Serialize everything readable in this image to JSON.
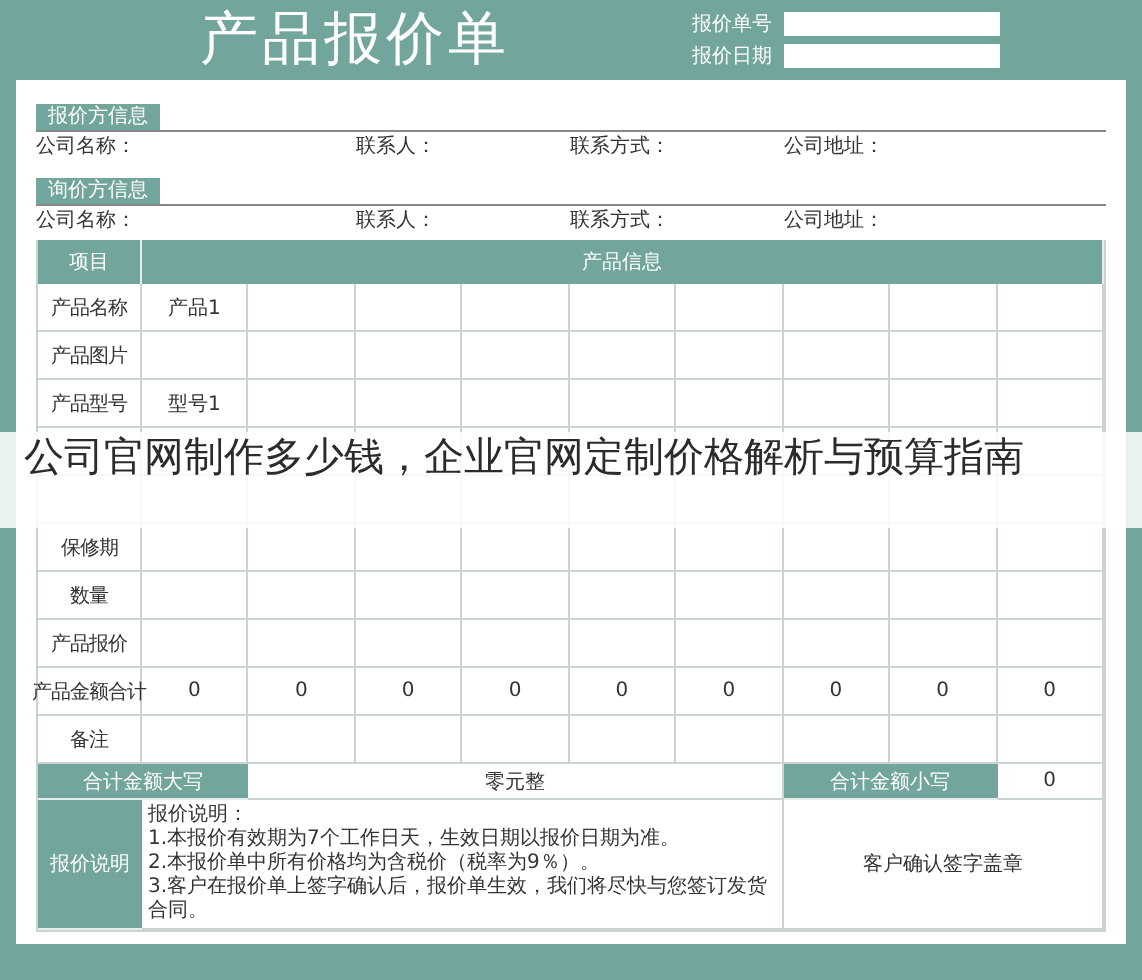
{
  "header": {
    "title": "产品报价单",
    "fields": [
      {
        "label": "报价单号"
      },
      {
        "label": "报价日期"
      }
    ]
  },
  "sections": [
    {
      "heading": "报价方信息",
      "fields": [
        "公司名称：",
        "联系人：",
        "联系方式：",
        "公司地址："
      ]
    },
    {
      "heading": "询价方信息",
      "fields": [
        "公司名称：",
        "联系人：",
        "联系方式：",
        "公司地址："
      ]
    }
  ],
  "table": {
    "columns": [
      "项目",
      "产品信息"
    ],
    "rows": [
      {
        "label": "产品名称",
        "values": [
          "产品1"
        ]
      },
      {
        "label": "产品图片",
        "values": []
      },
      {
        "label": "产品型号",
        "values": [
          "型号1"
        ]
      },
      {
        "values": []
      },
      {
        "values": []
      },
      {
        "label": "保修期",
        "values": []
      },
      {
        "label": "数量",
        "values": []
      },
      {
        "label": "产品报价",
        "values": []
      },
      {
        "label": "产品金额合计",
        "values": [
          "0",
          "0",
          "0",
          "0",
          "0",
          "0",
          "0",
          "0",
          "0"
        ]
      },
      {
        "label": "备注",
        "values": []
      }
    ]
  },
  "totals": {
    "upper_label": "合计金额大写",
    "upper_value": "零元整",
    "lower_label": "合计金额小写",
    "lower_value": "0"
  },
  "notes": {
    "label": "报价说明",
    "heading": "报价说明：",
    "lines": [
      "1.本报价有效期为7个工作日天，生效日期以报价日期为准。",
      "2.本报价单中所有价格均为含税价（税率为9％）。",
      "3.客户在报价单上签字确认后，报价单生效，我们将尽快与您签订发货合同。"
    ],
    "signature": "客户确认签字盖章"
  },
  "caption": "公司官网制作多少钱，企业官网定制价格解析与预算指南"
}
